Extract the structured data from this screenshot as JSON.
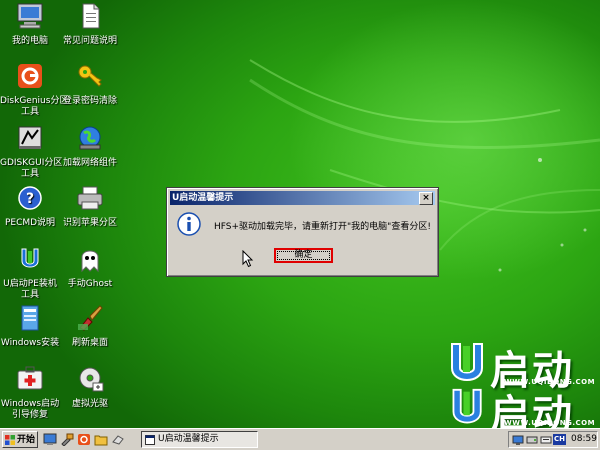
{
  "desktop": {
    "icons": [
      {
        "label1": "我的电脑",
        "label2": "",
        "icon": "my-computer-icon"
      },
      {
        "label1": "常见问题说明",
        "label2": "",
        "icon": "document-icon"
      },
      {
        "label1": "DiskGenius分区",
        "label2": "工具",
        "icon": "diskgenius-icon"
      },
      {
        "label1": "登录密码清除",
        "label2": "",
        "icon": "key-icon"
      },
      {
        "label1": "GDISKGUI分区",
        "label2": "工具",
        "icon": "gdisk-icon"
      },
      {
        "label1": "加载网络组件",
        "label2": "",
        "icon": "network-globe-icon"
      },
      {
        "label1": "PECMD说明",
        "label2": "",
        "icon": "help-icon"
      },
      {
        "label1": "识别苹果分区",
        "label2": "",
        "icon": "printer-icon"
      },
      {
        "label1": "U启动PE装机",
        "label2": "工具",
        "icon": "u-logo-icon"
      },
      {
        "label1": "手动Ghost",
        "label2": "",
        "icon": "ghost-icon"
      },
      {
        "label1": "Windows安装",
        "label2": "",
        "icon": "windows-setup-icon"
      },
      {
        "label1": "刷新桌面",
        "label2": "",
        "icon": "brush-icon"
      },
      {
        "label1": "Windows启动",
        "label2": "引导修复",
        "icon": "first-aid-icon"
      },
      {
        "label1": "虚拟光驱",
        "label2": "",
        "icon": "cd-drive-icon"
      }
    ],
    "brand": {
      "text": "启动",
      "url": "WWW.UQIDONG.COM"
    }
  },
  "dialog": {
    "title": "U启动温馨提示",
    "close_label": "×",
    "message": "HFS+驱动加载完毕，请重新打开\"我的电脑\"查看分区!",
    "ok_label": "确定"
  },
  "taskbar": {
    "start_label": "开始",
    "task_item_label": "U启动温馨提示",
    "input_badge": "CH",
    "clock": "08:59"
  }
}
